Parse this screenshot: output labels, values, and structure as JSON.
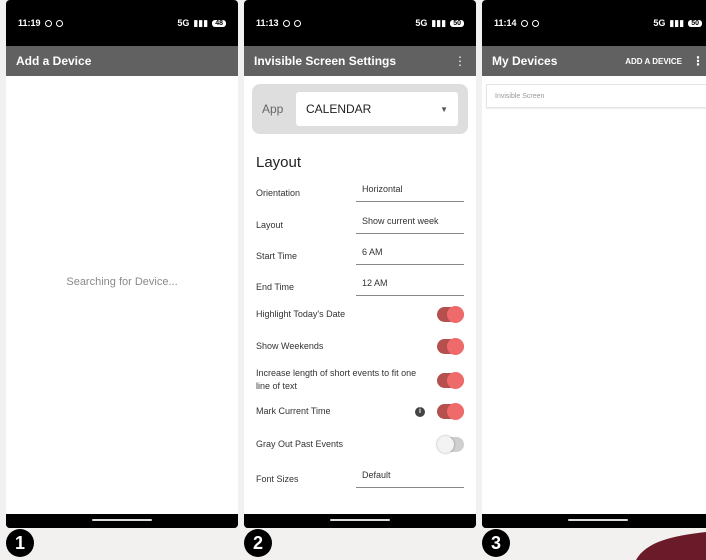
{
  "screens": [
    {
      "time": "11:19",
      "network": "5G",
      "battery": "48",
      "appbar_title": "Add a Device",
      "status_text": "Searching for Device..."
    },
    {
      "time": "11:13",
      "network": "5G",
      "battery": "50",
      "appbar_title": "Invisible Screen Settings",
      "app_label": "App",
      "app_value": "CALENDAR",
      "section_title": "Layout",
      "fields": [
        {
          "label": "Orientation",
          "value": "Horizontal"
        },
        {
          "label": "Layout",
          "value": "Show current week"
        },
        {
          "label": "Start Time",
          "value": "6 AM"
        },
        {
          "label": "End Time",
          "value": "12 AM"
        }
      ],
      "toggles": [
        {
          "label": "Highlight Today's Date",
          "on": true
        },
        {
          "label": "Show Weekends",
          "on": true
        },
        {
          "label": "Increase length of short events to fit one line of text",
          "on": true
        },
        {
          "label": "Mark Current Time",
          "on": true
        },
        {
          "label": "Gray Out Past Events",
          "on": false
        }
      ],
      "font_size_label": "Font Sizes",
      "font_size_value": "Default"
    },
    {
      "time": "11:14",
      "network": "5G",
      "battery": "50",
      "appbar_title": "My Devices",
      "add_device_label": "ADD A DEVICE",
      "devices": [
        "Invisible Screen"
      ]
    }
  ],
  "badges": [
    "1",
    "2",
    "3"
  ],
  "colors": {
    "appbar": "#616161",
    "toggle_on": "#ef6b6b",
    "toggle_off": "#cfcfcf"
  }
}
